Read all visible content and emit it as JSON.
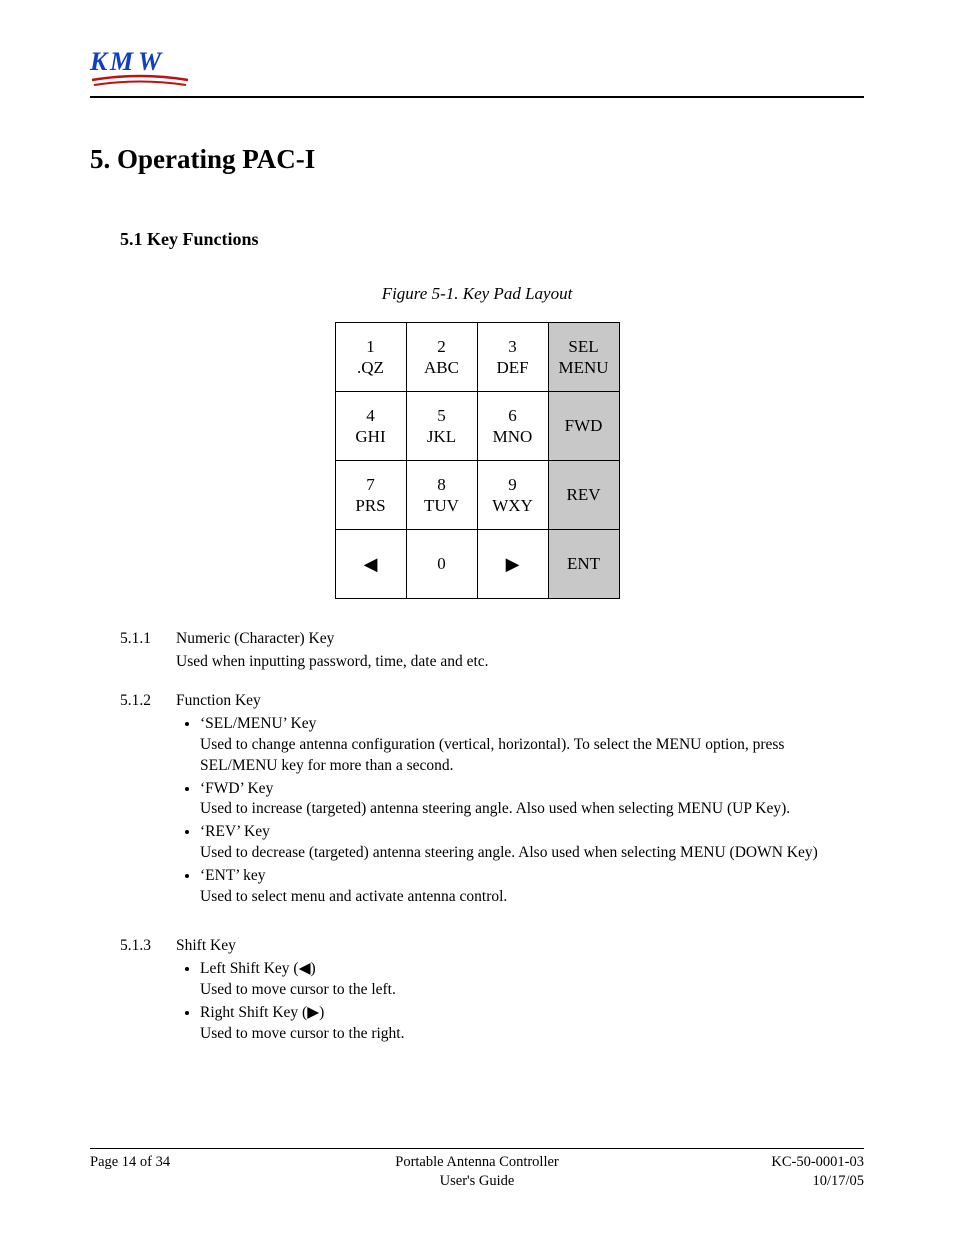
{
  "logo_text": "KMW",
  "section_title": "5. Operating PAC-I",
  "subsection_title": "5.1 Key Functions",
  "figure_caption": "Figure 5-1. Key Pad Layout",
  "keypad": {
    "rows": [
      [
        {
          "l1": "1",
          "l2": ".QZ",
          "func": false
        },
        {
          "l1": "2",
          "l2": "ABC",
          "func": false
        },
        {
          "l1": "3",
          "l2": "DEF",
          "func": false
        },
        {
          "l1": "SEL",
          "l2": "MENU",
          "func": true
        }
      ],
      [
        {
          "l1": "4",
          "l2": "GHI",
          "func": false
        },
        {
          "l1": "5",
          "l2": "JKL",
          "func": false
        },
        {
          "l1": "6",
          "l2": "MNO",
          "func": false
        },
        {
          "l1": "FWD",
          "l2": "",
          "func": true
        }
      ],
      [
        {
          "l1": "7",
          "l2": "PRS",
          "func": false
        },
        {
          "l1": "8",
          "l2": "TUV",
          "func": false
        },
        {
          "l1": "9",
          "l2": "WXY",
          "func": false
        },
        {
          "l1": "REV",
          "l2": "",
          "func": true
        }
      ],
      [
        {
          "l1": "◀",
          "l2": "",
          "func": false,
          "arrow": true
        },
        {
          "l1": "0",
          "l2": "",
          "func": false
        },
        {
          "l1": "▶",
          "l2": "",
          "func": false,
          "arrow": true
        },
        {
          "l1": "ENT",
          "l2": "",
          "func": true
        }
      ]
    ]
  },
  "items": [
    {
      "num": "5.1.1",
      "title": "Numeric (Character) Key",
      "desc": "Used when inputting password, time, date and etc.",
      "bullets": []
    },
    {
      "num": "5.1.2",
      "title": "Function Key",
      "desc": "",
      "bullets": [
        {
          "title": "‘SEL/MENU’ Key",
          "desc": "Used to change antenna configuration (vertical, horizontal). To select the MENU option, press SEL/MENU key for more than a second."
        },
        {
          "title": "‘FWD’ Key",
          "desc": "Used to increase (targeted) antenna steering angle.  Also used when selecting MENU (UP Key)."
        },
        {
          "title": "‘REV’ Key",
          "desc": "Used to decrease (targeted) antenna steering angle.  Also used when selecting MENU (DOWN Key)"
        },
        {
          "title": "‘ENT’ key",
          "desc": "Used to select menu and activate antenna control."
        }
      ]
    },
    {
      "num": "5.1.3",
      "title": "Shift Key",
      "desc": "",
      "bullets": [
        {
          "title": "Left Shift Key (◀)",
          "desc": "Used to move cursor to the left."
        },
        {
          "title": "Right Shift Key (▶)",
          "desc": "Used to move cursor to the right."
        }
      ]
    }
  ],
  "footer": {
    "left": "Page 14 of 34",
    "center": "Portable Antenna Controller\nUser's Guide",
    "right": "KC-50-0001-03\n10/17/05"
  }
}
